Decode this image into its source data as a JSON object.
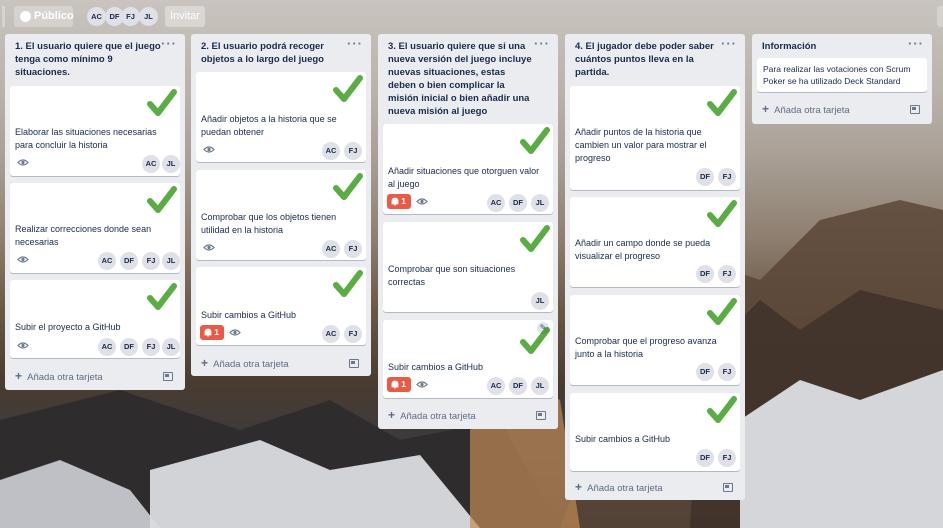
{
  "colors": {
    "card_bg": "#ffffff",
    "list_bg": "#ebecf0",
    "badge_red": "#eb5a46",
    "check_green": "#5aac44"
  },
  "topbar": {
    "public_label": "Público",
    "invite_label": "Invitar",
    "members": [
      "AC",
      "DF",
      "FJ",
      "JL"
    ]
  },
  "add_card_label": "Añada otra tarjeta",
  "lists": [
    {
      "title": "1. El usuario quiere que el juego tenga como mínimo 9 situaciones.",
      "cards": [
        {
          "title": "Elaborar las situaciones necesarias para concluir la historia",
          "members": [
            "AC",
            "JL"
          ]
        },
        {
          "title": "Realizar correcciones donde sean necesarias",
          "members": [
            "AC",
            "DF",
            "FJ",
            "JL"
          ]
        },
        {
          "title": "Subir el proyecto a GitHub",
          "members": [
            "AC",
            "DF",
            "FJ",
            "JL"
          ]
        }
      ]
    },
    {
      "title": "2. El usuario podrá recoger objetos a lo largo del juego",
      "cards": [
        {
          "title": "Añadir objetos a la historia que se puedan obtener",
          "members": [
            "AC",
            "FJ"
          ]
        },
        {
          "title": "Comprobar que los objetos tienen utilidad en la historia",
          "members": [
            "AC",
            "FJ"
          ]
        },
        {
          "title": "Subir cambios a GitHub",
          "badge": "1",
          "members": [
            "AC",
            "FJ"
          ]
        }
      ]
    },
    {
      "title": "3. El usuario quiere que si una nueva versión del juego incluye nuevas situaciones, estas deben o bien complicar la misión inicial o bien añadir una nueva misión al juego",
      "cards": [
        {
          "title": "Añadir situaciones que otorguen valor al juego",
          "badge": "1",
          "members": [
            "AC",
            "DF",
            "JL"
          ]
        },
        {
          "title": "Comprobar que son situaciones correctas",
          "members": [
            "JL"
          ]
        },
        {
          "title": "Subir cambios a GitHub",
          "badge": "1",
          "members": [
            "AC",
            "DF",
            "JL"
          ]
        }
      ]
    },
    {
      "title": "4. El jugador debe poder saber cuántos puntos lleva en la partida.",
      "cards": [
        {
          "title": "Añadir puntos de la historia que cambien un valor para mostrar el progreso",
          "members": [
            "DF",
            "FJ"
          ]
        },
        {
          "title": "Añadir un campo donde se pueda visualizar el progreso",
          "members": [
            "DF",
            "FJ"
          ]
        },
        {
          "title": "Comprobar que el progreso avanza junto a la historia",
          "members": [
            "DF",
            "FJ"
          ]
        },
        {
          "title": "Subir cambios a GitHub",
          "members": [
            "DF",
            "FJ"
          ]
        }
      ]
    },
    {
      "title": "Información",
      "cards": [
        {
          "title": "Para realizar las votaciones con Scrum Poker se ha utilizado Deck Standard"
        }
      ]
    }
  ]
}
